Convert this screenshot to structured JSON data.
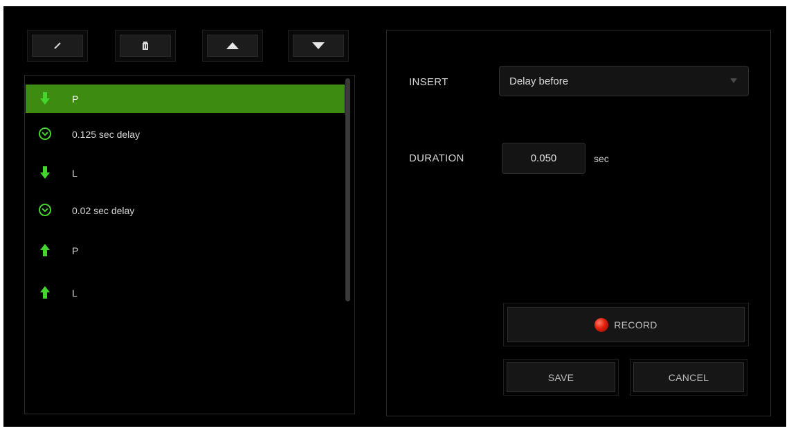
{
  "toolbar": {
    "edit_icon": "pencil-icon",
    "delete_icon": "trash-icon",
    "move_up_icon": "triangle-up-icon",
    "move_down_icon": "triangle-down-icon"
  },
  "macro_list": {
    "items": [
      {
        "type": "key-down",
        "icon": "arrow-down-icon",
        "label": "P",
        "selected": true
      },
      {
        "type": "delay",
        "icon": "clock-icon",
        "label": "0.125 sec delay",
        "selected": false
      },
      {
        "type": "key-down",
        "icon": "arrow-down-icon",
        "label": "L",
        "selected": false
      },
      {
        "type": "delay",
        "icon": "clock-icon",
        "label": "0.02 sec delay",
        "selected": false
      },
      {
        "type": "key-up",
        "icon": "arrow-up-icon",
        "label": "P",
        "selected": false
      },
      {
        "type": "key-up",
        "icon": "arrow-up-icon",
        "label": "L",
        "selected": false
      }
    ]
  },
  "editor": {
    "insert_label": "INSERT",
    "insert_value": "Delay before",
    "duration_label": "DURATION",
    "duration_value": "0.050",
    "duration_unit": "sec",
    "record_label": "RECORD",
    "save_label": "SAVE",
    "cancel_label": "CANCEL"
  },
  "colors": {
    "accent_green": "#44d62c",
    "selected_row": "#3d8b10",
    "record_red": "#e0200c"
  }
}
